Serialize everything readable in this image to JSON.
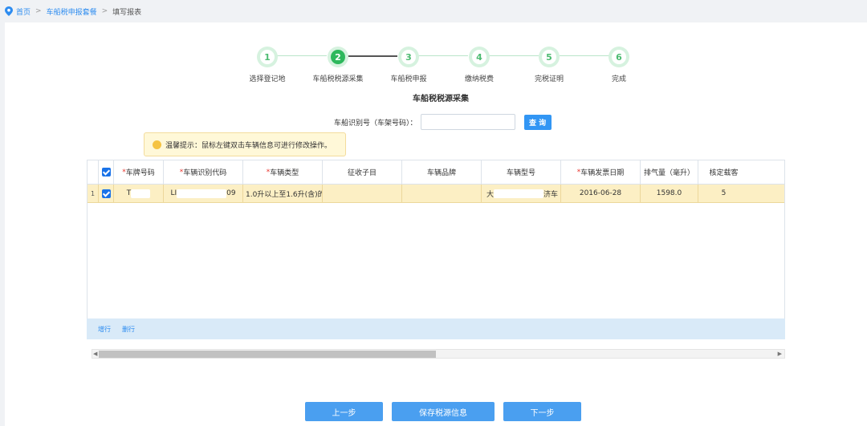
{
  "breadcrumb": {
    "home": "首页",
    "sep1": ">",
    "section": "车船税申报套餐",
    "sep2": ">",
    "current": "填写报表"
  },
  "steps": [
    {
      "num": "1",
      "label": "选择登记地"
    },
    {
      "num": "2",
      "label": "车船税税源采集"
    },
    {
      "num": "3",
      "label": "车船税申报"
    },
    {
      "num": "4",
      "label": "缴纳税费"
    },
    {
      "num": "5",
      "label": "完税证明"
    },
    {
      "num": "6",
      "label": "完成"
    }
  ],
  "section_title": "车船税税源采集",
  "search": {
    "label": "车船识别号（车架号码）：",
    "value": "",
    "button": "查 询"
  },
  "tip": "温馨提示：鼠标左键双击车辆信息可进行修改操作。",
  "table": {
    "headers": [
      {
        "label": "车牌号码",
        "required": "*"
      },
      {
        "label": "车辆识别代码",
        "required": "*"
      },
      {
        "label": "车辆类型",
        "required": "*"
      },
      {
        "label": "征收子目",
        "required": ""
      },
      {
        "label": "车辆品牌",
        "required": ""
      },
      {
        "label": "车辆型号",
        "required": ""
      },
      {
        "label": "车辆发票日期",
        "required": "*"
      },
      {
        "label": "排气量（毫升）",
        "required": ""
      },
      {
        "label": "核定载客",
        "required": ""
      }
    ],
    "rows": [
      {
        "index": "1",
        "plate": "T",
        "vin_prefix": "LI",
        "vin_suffix": "09",
        "type": "1.0升以上至1.6升(含)的乘!",
        "subitem": "",
        "brand": "",
        "model_prefix": "大",
        "model_suffix": "济车",
        "invoice_date": "2016-06-28",
        "displacement": "1598.0",
        "seats": "5"
      }
    ]
  },
  "footer_links": {
    "add": "增行",
    "delete": "删行"
  },
  "buttons": {
    "prev": "上一步",
    "save": "保存税源信息",
    "next": "下一步"
  },
  "colors": {
    "accent": "#2db85c",
    "primary": "#3296f4",
    "row_highlight": "#fcefc4"
  },
  "icons": {
    "location": "location-pin-icon",
    "smile": "smile-icon",
    "check": "checkbox-checked-icon"
  }
}
